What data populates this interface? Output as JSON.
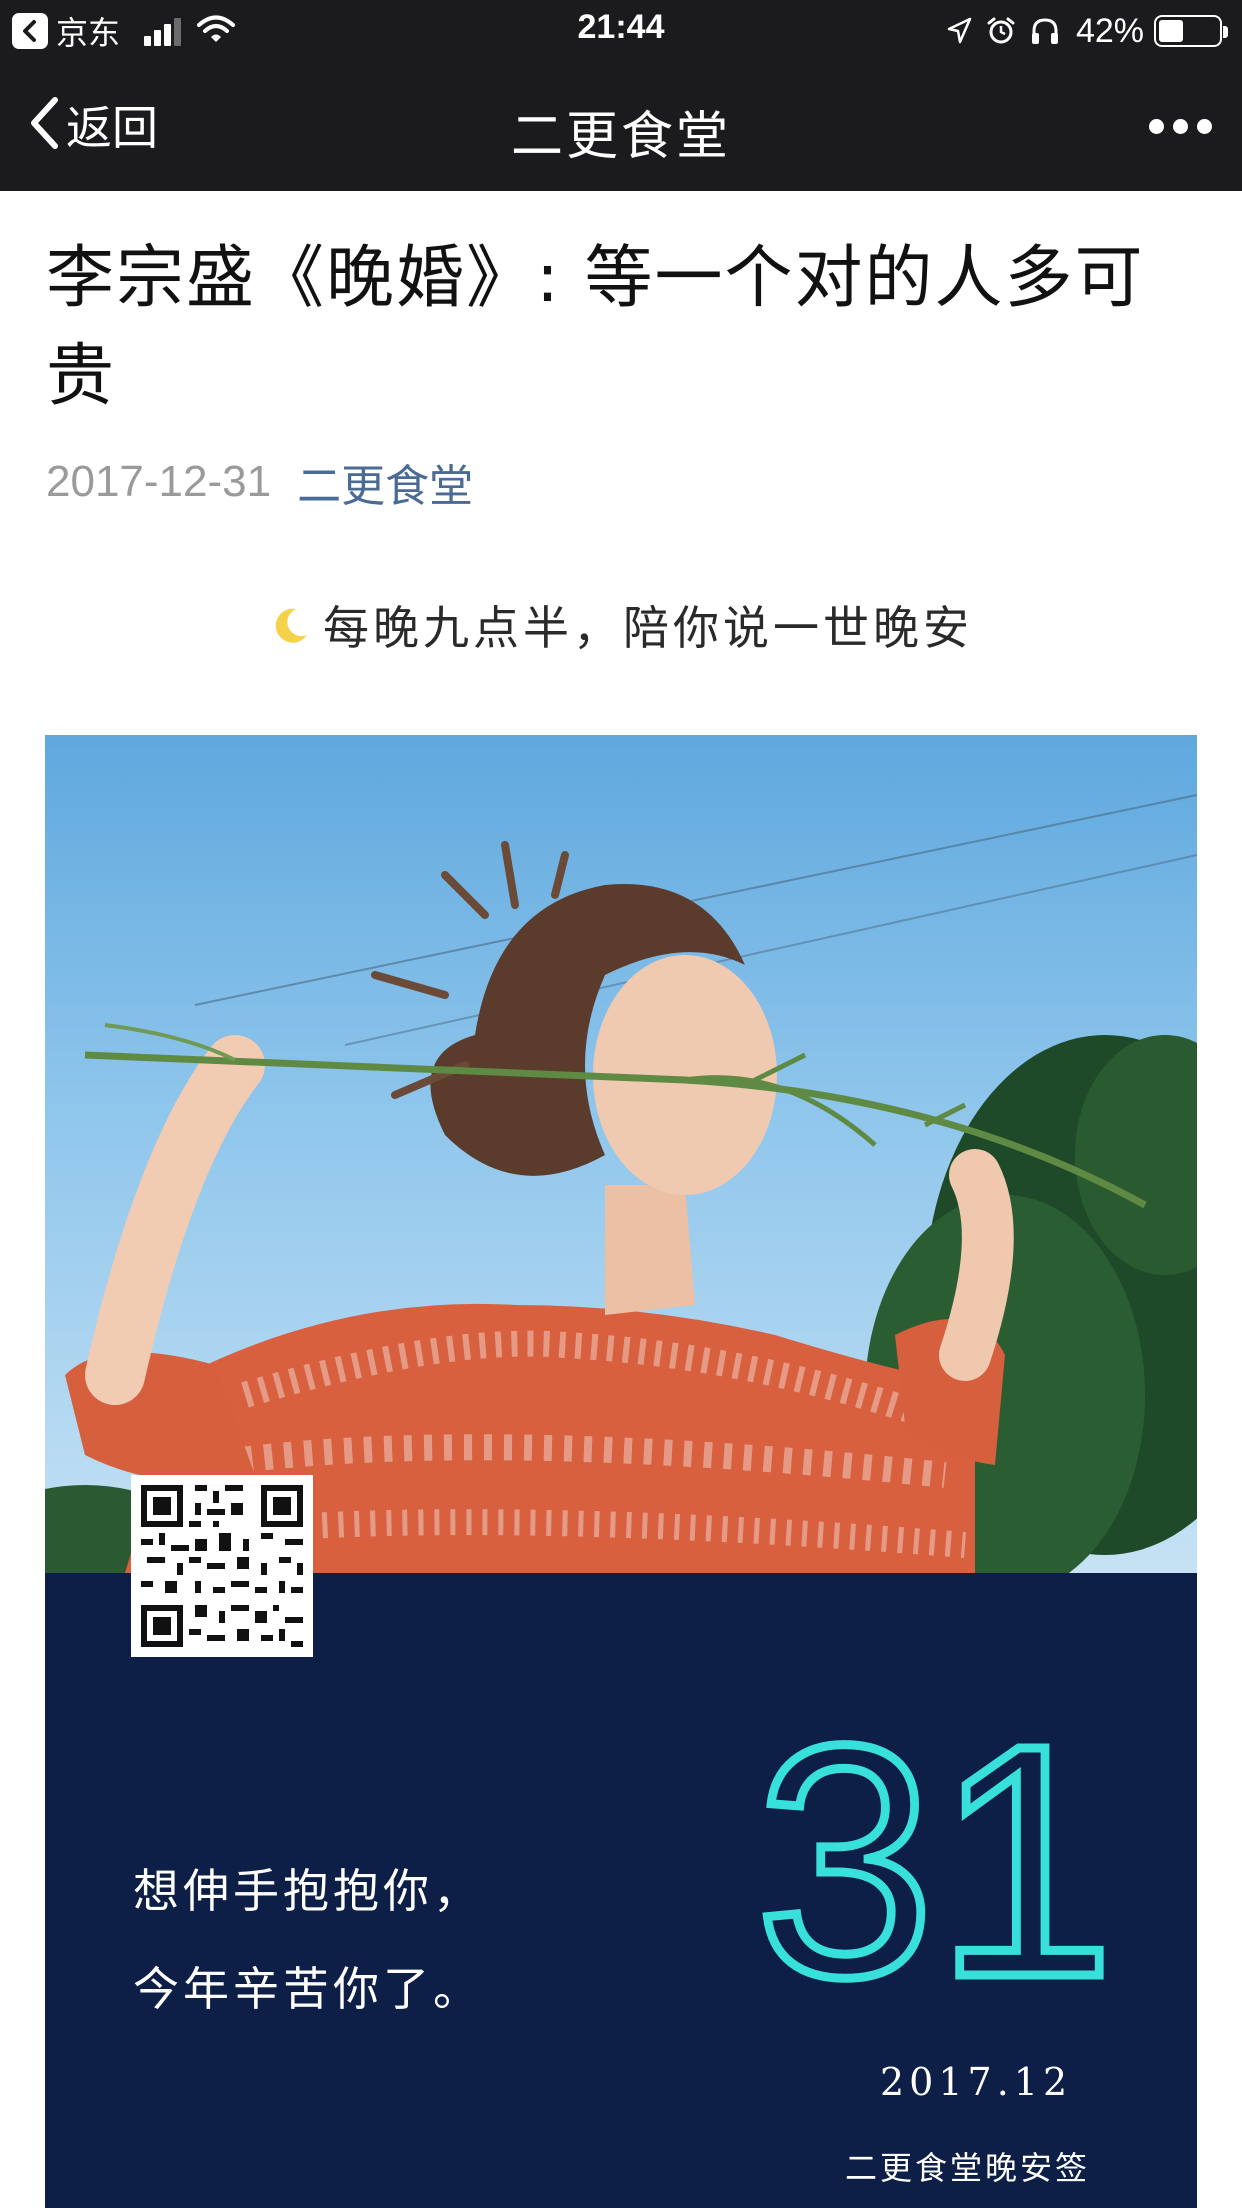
{
  "status_bar": {
    "back_app": "京东",
    "time": "21:44",
    "battery_percent": "42%",
    "battery_level": 0.42,
    "icons": [
      "back-arrow-icon",
      "signal-icon",
      "wifi-icon",
      "location-icon",
      "alarm-icon",
      "headphones-icon",
      "battery-icon"
    ]
  },
  "nav": {
    "back_label": "返回",
    "title": "二更食堂",
    "more_icon": "more-icon"
  },
  "article": {
    "title": "李宗盛《晚婚》: 等一个对的人多可贵",
    "date": "2017-12-31",
    "account": "二更食堂",
    "tagline": "每晚九点半，陪你说一世晚安"
  },
  "card": {
    "quote_line1": "想伸手抱抱你，",
    "quote_line2": "今年辛苦你了。",
    "day": "31",
    "month": "2017.12",
    "signature": "二更食堂晚安签"
  },
  "colors": {
    "bar_bg": "#1b1b1d",
    "link": "#4a6b95",
    "card_bg": "#0d1f46",
    "day_number": "#38e0dc",
    "moon": "#f4d24a"
  }
}
